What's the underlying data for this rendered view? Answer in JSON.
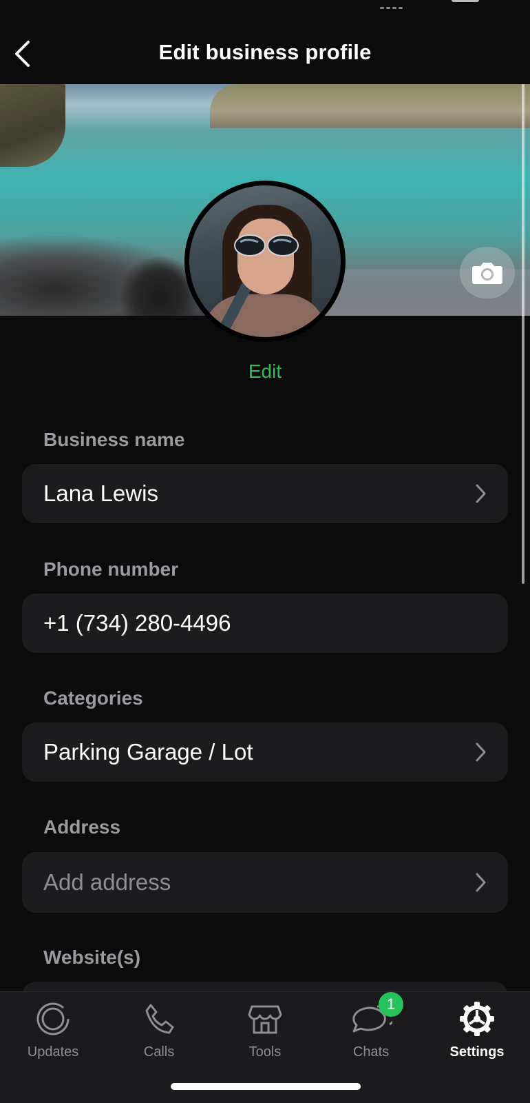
{
  "header": {
    "title": "Edit business profile"
  },
  "profile": {
    "edit_label": "Edit"
  },
  "fields": [
    {
      "label": "Business name",
      "value": "Lana Lewis",
      "placeholder": false,
      "chevron": true
    },
    {
      "label": "Phone number",
      "value": "+1 (734) 280-4496",
      "placeholder": false,
      "chevron": false
    },
    {
      "label": "Categories",
      "value": "Parking Garage / Lot",
      "placeholder": false,
      "chevron": true
    },
    {
      "label": "Address",
      "value": "Add address",
      "placeholder": true,
      "chevron": true
    },
    {
      "label": "Website(s)",
      "value": "",
      "placeholder": false,
      "chevron": false
    }
  ],
  "tabs": [
    {
      "label": "Updates",
      "icon": "updates-icon"
    },
    {
      "label": "Calls",
      "icon": "phone-icon"
    },
    {
      "label": "Tools",
      "icon": "store-icon"
    },
    {
      "label": "Chats",
      "icon": "chat-bubbles-icon",
      "badge": "1"
    },
    {
      "label": "Settings",
      "icon": "gear-icon",
      "active": true
    }
  ],
  "colors": {
    "accent": "#25c35a",
    "background": "#0b0b0c",
    "field_bg": "#1c1c1e"
  }
}
